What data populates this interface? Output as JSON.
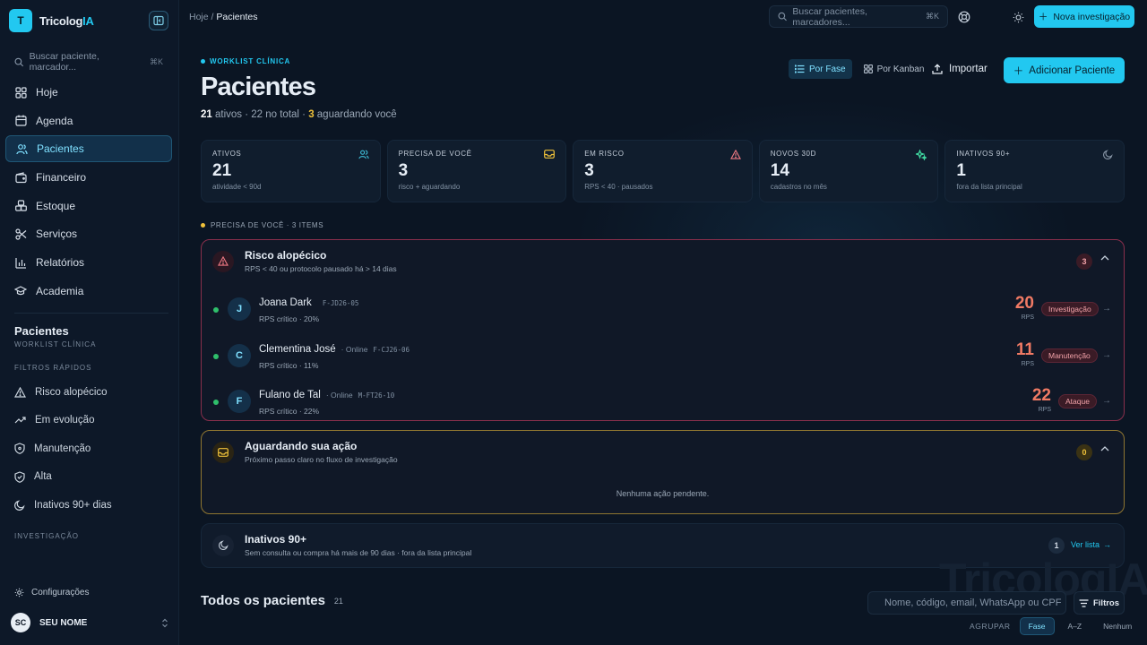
{
  "app": {
    "logo_letter": "T",
    "name_main": "Tricolog",
    "name_accent": "IA",
    "accent_color": "#22c8f0"
  },
  "sidebar": {
    "search_placeholder": "Buscar paciente, marcador...",
    "search_kbd": "⌘K",
    "nav": [
      {
        "label": "Hoje",
        "icon": "grid-icon"
      },
      {
        "label": "Agenda",
        "icon": "calendar-icon"
      },
      {
        "label": "Pacientes",
        "icon": "users-icon",
        "active": true
      },
      {
        "label": "Financeiro",
        "icon": "wallet-icon"
      },
      {
        "label": "Estoque",
        "icon": "boxes-icon"
      },
      {
        "label": "Serviços",
        "icon": "scissors-icon"
      },
      {
        "label": "Relatórios",
        "icon": "bar-chart-icon"
      },
      {
        "label": "Academia",
        "icon": "graduation-cap-icon"
      }
    ],
    "section_title": "Pacientes",
    "section_sub": "WORKLIST CLÍNICA",
    "filters_label": "FILTROS RÁPIDOS",
    "filters": [
      {
        "label": "Risco alopécico",
        "icon": "warning-icon"
      },
      {
        "label": "Em evolução",
        "icon": "trending-up-icon"
      },
      {
        "label": "Manutenção",
        "icon": "shield-icon"
      },
      {
        "label": "Alta",
        "icon": "shield-check-icon"
      },
      {
        "label": "Inativos 90+ dias",
        "icon": "moon-icon"
      }
    ],
    "investigation_label": "INVESTIGAÇÃO",
    "settings_label": "Configurações",
    "user_initials": "SC",
    "user_name": "SEU NOME"
  },
  "topbar": {
    "crumb_root": "Hoje",
    "crumb_sep": "/",
    "crumb_current": "Pacientes",
    "search_placeholder": "Buscar pacientes, marcadores...",
    "search_kbd": "⌘K",
    "new_button": "Nova investigação"
  },
  "page": {
    "eyebrow": "WORKLIST CLÍNICA",
    "title": "Pacientes",
    "active_count": "21",
    "active_text": " ativos · 22 no total · ",
    "waiting_count": "3",
    "waiting_text": " aguardando você",
    "view_phase": "Por Fase",
    "view_kanban": "Por Kanban",
    "import_label": "Importar",
    "add_label": "Adicionar Paciente"
  },
  "stats": [
    {
      "label": "ATIVOS",
      "value": "21",
      "caption": "atividade < 90d",
      "icon": "users-icon",
      "color": "#3fbfd8"
    },
    {
      "label": "PRECISA DE VOCÊ",
      "value": "3",
      "caption": "risco + aguardando",
      "icon": "inbox-icon",
      "color": "#f0c23a"
    },
    {
      "label": "EM RISCO",
      "value": "3",
      "caption": "RPS < 40 · pausados",
      "icon": "warning-icon",
      "color": "#f07a84"
    },
    {
      "label": "NOVOS 30D",
      "value": "14",
      "caption": "cadastros no mês",
      "icon": "sparkle-icon",
      "color": "#3fd8a0"
    },
    {
      "label": "INATIVOS 90+",
      "value": "1",
      "caption": "fora da lista principal",
      "icon": "moon-icon",
      "color": "#8a98a9"
    }
  ],
  "needs_you": {
    "label": "PRECISA DE VOCÊ · 3 ITEMS"
  },
  "risk_panel": {
    "title": "Risco alopécico",
    "subtitle": "RPS < 40 ou protocolo pausado há > 14 dias",
    "count": "3",
    "patients": [
      {
        "initial": "J",
        "name": "Joana Dark",
        "online": "",
        "code": "F-JD26-05",
        "rps_text": "RPS crítico · 20%",
        "score": "20",
        "score_label": "RPS",
        "tag": "Investigação"
      },
      {
        "initial": "C",
        "name": "Clementina José",
        "online": "· Online",
        "code": "F-CJ26-06",
        "rps_text": "RPS crítico · 11%",
        "score": "11",
        "score_label": "RPS",
        "tag": "Manutenção"
      },
      {
        "initial": "F",
        "name": "Fulano de Tal",
        "online": "· Online",
        "code": "M-FT26-10",
        "rps_text": "RPS crítico · 22%",
        "score": "22",
        "score_label": "RPS",
        "tag": "Ataque"
      }
    ]
  },
  "wait_panel": {
    "title": "Aguardando sua ação",
    "subtitle": "Próximo passo claro no fluxo de investigação",
    "count": "0",
    "empty": "Nenhuma ação pendente."
  },
  "inactive_panel": {
    "title": "Inativos 90+",
    "subtitle": "Sem consulta ou compra há mais de 90 dias · fora da lista principal",
    "count": "1",
    "link": "Ver lista"
  },
  "all_patients": {
    "title": "Todos os pacientes",
    "count": "21",
    "search_placeholder": "Nome, código, email, WhatsApp ou CPF",
    "filter_label": "Filtros",
    "group_label": "AGRUPAR",
    "group_options": [
      "Fase",
      "A–Z",
      "Nenhum"
    ],
    "group_selected": "Fase"
  },
  "watermark": "TricologIA"
}
